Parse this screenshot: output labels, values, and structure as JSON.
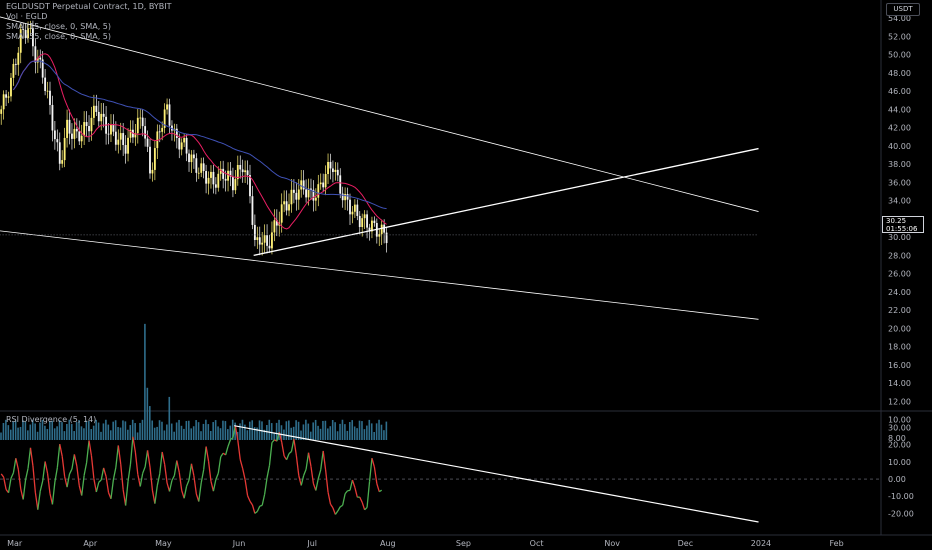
{
  "header": {
    "symbol_line": "EGLDUSDT Perpetual Contract, 1D, BYBIT",
    "vol_line": "Vol · EGLD",
    "sma1_line": "SMA (15, close, 0, SMA, 5)",
    "sma2_line": "SMA (55, close, 0, SMA, 5)",
    "currency": "USDT"
  },
  "price_tag": {
    "price": "30.25",
    "countdown": "01:55:06"
  },
  "rsi_label": "RSI Divergence (5, 14)",
  "colors": {
    "up": "#26a69a",
    "down": "#ef5350",
    "bull_candle": "#fff176",
    "bear_candle": "#f5f5f5",
    "sma_fast": "#e91e63",
    "sma_slow": "#3f51b5",
    "rsi_up": "#4caf50",
    "rsi_down": "#e53935",
    "trendline": "#ffffff",
    "volume": "#2f6e8c"
  },
  "chart_data": {
    "type": "candlestick",
    "x_ticks": [
      "Mar",
      "Apr",
      "May",
      "Jun",
      "Jul",
      "Aug",
      "Sep",
      "Oct",
      "Nov",
      "Dec",
      "2024",
      "Feb"
    ],
    "price_axis": {
      "ylim": [
        8,
        54
      ],
      "ticks": [
        "54.00",
        "52.00",
        "50.00",
        "48.00",
        "46.00",
        "44.00",
        "42.00",
        "40.00",
        "38.00",
        "36.00",
        "34.00",
        "32.00",
        "30.00",
        "28.00",
        "26.00",
        "24.00",
        "22.00",
        "20.00",
        "18.00",
        "16.00",
        "14.00",
        "12.00",
        "10.00",
        "8.00"
      ]
    },
    "rsi_axis": {
      "ylim": [
        -25,
        32
      ],
      "ticks": [
        "30.00",
        "20.00",
        "10.00",
        "0.00",
        "-10.00",
        "-20.00"
      ]
    },
    "close_anchors": [
      [
        0,
        44
      ],
      [
        4,
        47
      ],
      [
        8,
        52
      ],
      [
        11,
        53
      ],
      [
        14,
        50
      ],
      [
        17,
        48
      ],
      [
        20,
        44
      ],
      [
        24,
        38
      ],
      [
        27,
        42
      ],
      [
        31,
        41
      ],
      [
        35,
        42
      ],
      [
        39,
        44
      ],
      [
        43,
        42
      ],
      [
        47,
        41
      ],
      [
        51,
        40
      ],
      [
        55,
        42
      ],
      [
        58,
        43
      ],
      [
        61,
        37
      ],
      [
        65,
        42
      ],
      [
        68,
        44
      ],
      [
        71,
        41
      ],
      [
        75,
        40
      ],
      [
        79,
        38
      ],
      [
        83,
        37
      ],
      [
        87,
        36
      ],
      [
        91,
        37
      ],
      [
        95,
        36
      ],
      [
        99,
        38
      ],
      [
        102,
        35
      ],
      [
        104,
        29
      ],
      [
        106,
        30
      ],
      [
        109,
        29
      ],
      [
        112,
        31
      ],
      [
        115,
        33
      ],
      [
        118,
        34
      ],
      [
        121,
        35
      ],
      [
        124,
        35.5
      ],
      [
        127,
        34.5
      ],
      [
        130,
        35
      ],
      [
        133,
        37
      ],
      [
        136,
        38
      ],
      [
        138,
        36
      ],
      [
        141,
        34
      ],
      [
        144,
        33
      ],
      [
        147,
        32
      ],
      [
        150,
        31.5
      ],
      [
        153,
        31
      ],
      [
        156,
        30.5
      ],
      [
        158,
        30.25
      ]
    ],
    "volume_spikes": [
      [
        59,
        20.5
      ],
      [
        60,
        13.5
      ],
      [
        61,
        11.5
      ],
      [
        69,
        12.5
      ],
      [
        95,
        10
      ],
      [
        152,
        9.6
      ]
    ],
    "rsi_anchors": [
      [
        0,
        3
      ],
      [
        3,
        -8
      ],
      [
        6,
        12
      ],
      [
        9,
        -12
      ],
      [
        12,
        18
      ],
      [
        15,
        -18
      ],
      [
        18,
        10
      ],
      [
        21,
        -15
      ],
      [
        24,
        20
      ],
      [
        27,
        -5
      ],
      [
        30,
        14
      ],
      [
        33,
        -10
      ],
      [
        36,
        22
      ],
      [
        39,
        -8
      ],
      [
        42,
        6
      ],
      [
        45,
        -12
      ],
      [
        48,
        19
      ],
      [
        51,
        -16
      ],
      [
        54,
        24
      ],
      [
        57,
        -5
      ],
      [
        60,
        16
      ],
      [
        63,
        -15
      ],
      [
        66,
        15
      ],
      [
        69,
        -8
      ],
      [
        72,
        10
      ],
      [
        75,
        -12
      ],
      [
        78,
        8
      ],
      [
        81,
        -14
      ],
      [
        84,
        18
      ],
      [
        87,
        -8
      ],
      [
        90,
        12
      ],
      [
        93,
        18
      ],
      [
        96,
        30
      ],
      [
        99,
        5
      ],
      [
        102,
        -14
      ],
      [
        105,
        -20
      ],
      [
        108,
        -10
      ],
      [
        111,
        20
      ],
      [
        114,
        26
      ],
      [
        117,
        10
      ],
      [
        120,
        22
      ],
      [
        123,
        -5
      ],
      [
        126,
        14
      ],
      [
        129,
        -8
      ],
      [
        132,
        15
      ],
      [
        135,
        -16
      ],
      [
        138,
        -20
      ],
      [
        141,
        -10
      ],
      [
        144,
        -2
      ],
      [
        147,
        -12
      ],
      [
        150,
        -18
      ],
      [
        152,
        14
      ],
      [
        154,
        -3
      ],
      [
        156,
        -8
      ]
    ],
    "trendlines_price": [
      {
        "name": "upper-falling",
        "from": [
          -10,
          54.8
        ],
        "to": [
          311,
          32.8
        ]
      },
      {
        "name": "lower-falling",
        "from": [
          -10,
          31
        ],
        "to": [
          311,
          21
        ]
      },
      {
        "name": "rising-support",
        "from": [
          104,
          28
        ],
        "to": [
          311,
          39.7
        ]
      },
      {
        "name": "price-line",
        "from": [
          -10,
          30.25
        ],
        "to": [
          311,
          30.25
        ]
      }
    ],
    "trendlines_rsi": [
      {
        "name": "rsi-divergence",
        "from": [
          96,
          31
        ],
        "to": [
          311,
          -25
        ]
      }
    ],
    "n_bars": 159,
    "x_tick_bar_index": [
      6,
      37,
      67,
      98,
      128,
      159,
      190,
      220,
      251,
      281,
      312,
      343
    ]
  }
}
